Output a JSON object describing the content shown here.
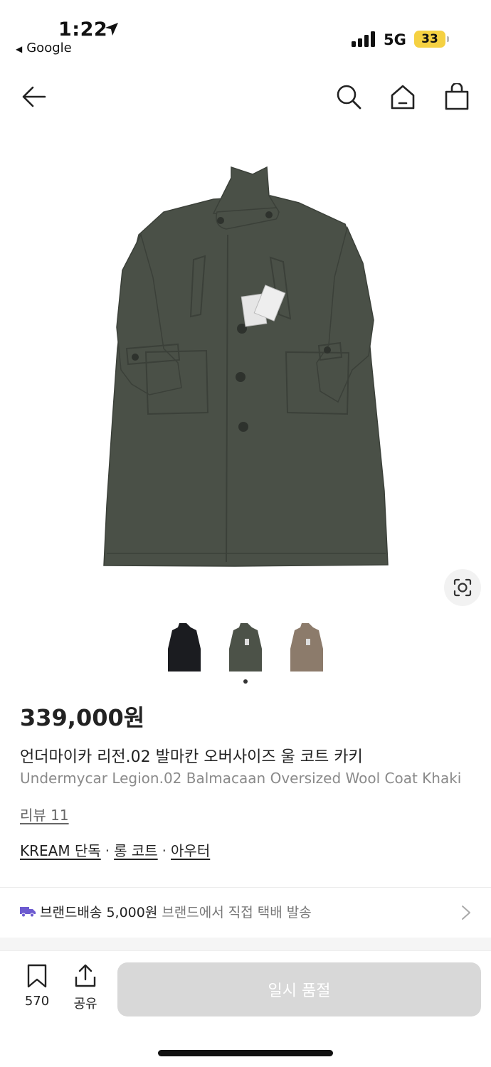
{
  "status": {
    "time": "1:22",
    "back_app": "Google",
    "network": "5G",
    "battery": "33"
  },
  "header": {
    "back_icon": "arrow-left-icon",
    "search_icon": "search-icon",
    "home_icon": "home-icon",
    "bag_icon": "shopping-bag-icon"
  },
  "product": {
    "price": "339,000원",
    "title_ko": "언더마이카 리전.02 발마칸 오버사이즈 울 코트 카키",
    "title_en": "Undermycar Legion.02 Balmacaan Oversized Wool Coat Khaki",
    "review": "리뷰 11",
    "tags": [
      "KREAM 단독",
      "롱 코트",
      "아우터"
    ],
    "colors": {
      "coat_main": "#4a5047",
      "thumb_black": "#1b1c20",
      "thumb_khaki": "#4c5248",
      "thumb_beige": "#8c7b6b"
    }
  },
  "delivery": {
    "label": "브랜드배송 5,000원",
    "sub": "브랜드에서 직접 택배 발송"
  },
  "bottom": {
    "bookmark_count": "570",
    "share_label": "공유",
    "soldout_label": "일시 품절"
  }
}
